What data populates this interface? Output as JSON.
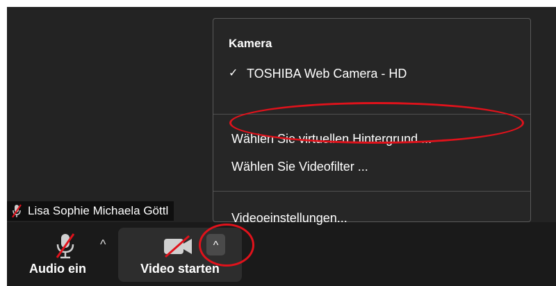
{
  "participant": {
    "name": "Lisa Sophie Michaela Göttl",
    "mic_icon": "mic-off-icon"
  },
  "toolbar": {
    "audio": {
      "label": "Audio ein",
      "icon": "mic-off-icon",
      "caret": "^"
    },
    "video": {
      "label": "Video starten",
      "icon": "video-off-icon"
    },
    "video_options_caret": "^"
  },
  "menu": {
    "heading": "Kamera",
    "camera_selected": {
      "check": "✓",
      "label": "TOSHIBA Web Camera - HD"
    },
    "virtual_background": "Wählen Sie virtuellen Hintergrund ...",
    "video_filter": "Wählen Sie Videofilter ...",
    "video_settings": "Videoeinstellungen..."
  },
  "annotations": {
    "highlight_color": "#e0121b"
  },
  "colors": {
    "background": "#232323",
    "toolbar": "#1a1a1a",
    "menu_background": "#262626",
    "mute_red": "#e0121b"
  }
}
